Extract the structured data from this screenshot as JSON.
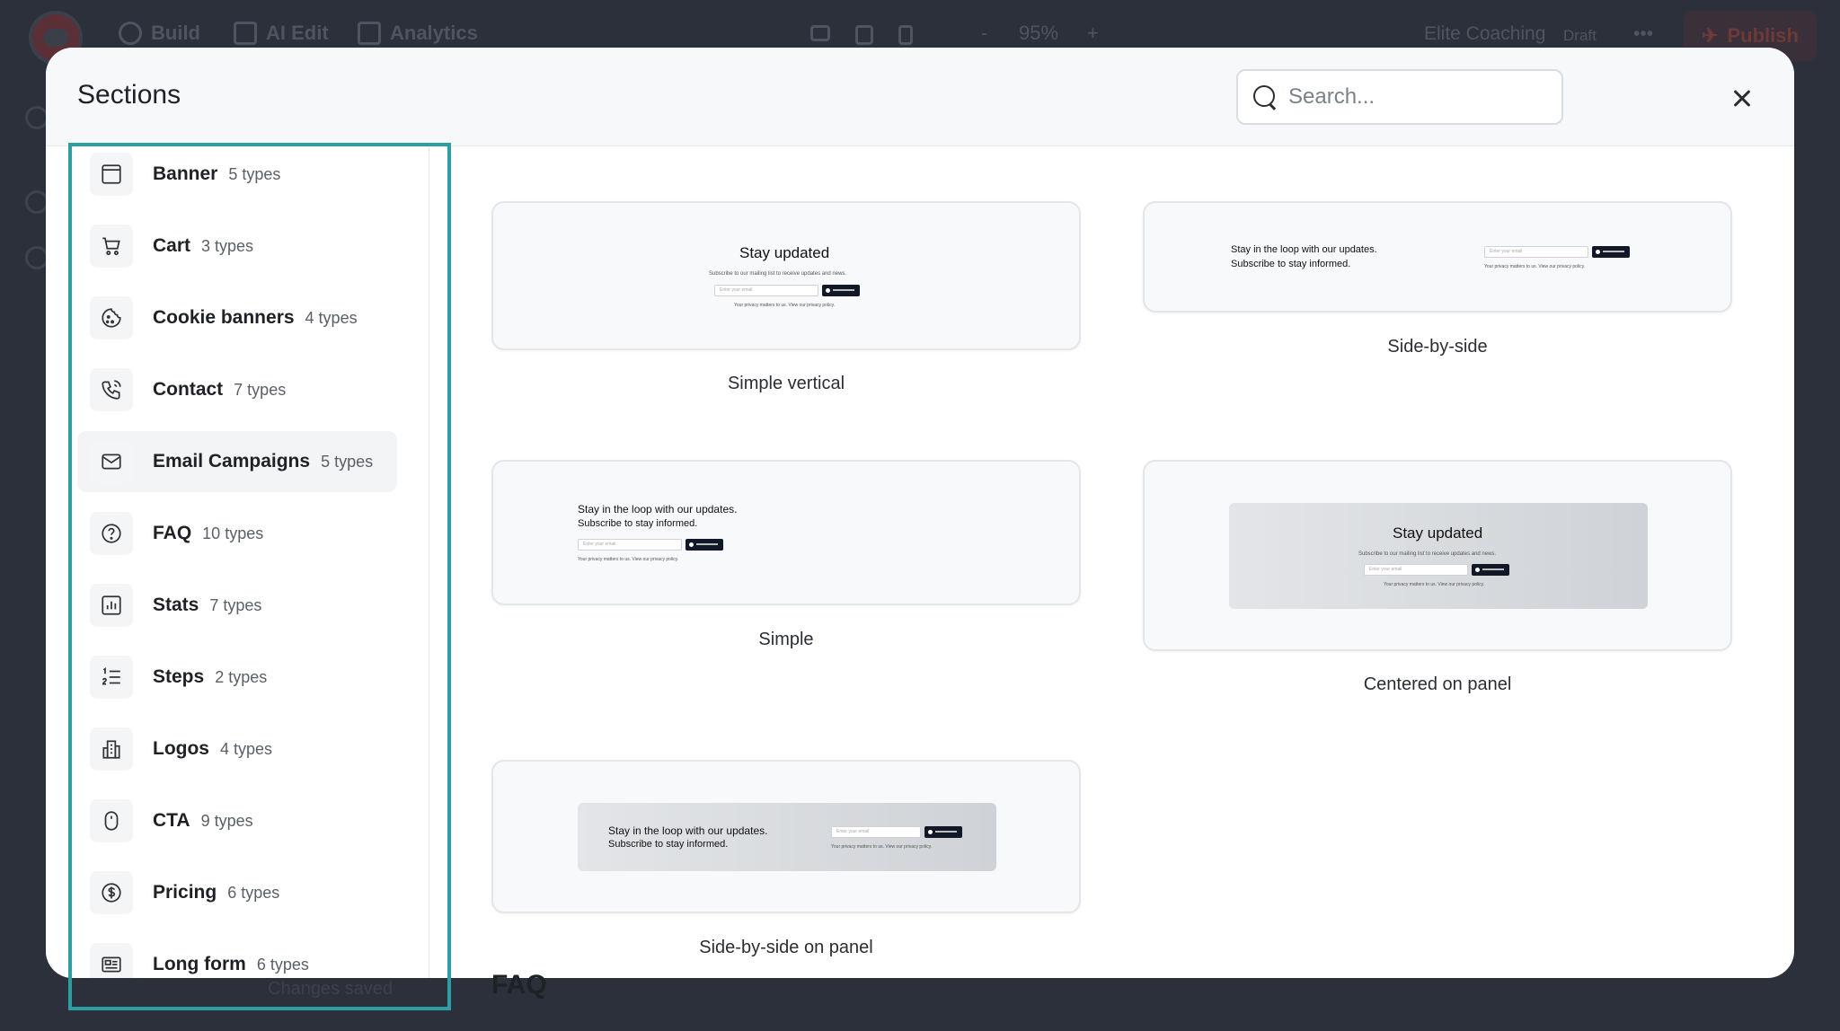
{
  "app": {
    "nav": [
      {
        "label": "Build",
        "icon": "globe-icon"
      },
      {
        "label": "AI Edit",
        "icon": "magic-wand-icon"
      },
      {
        "label": "Analytics",
        "icon": "bar-chart-icon"
      }
    ],
    "zoom_minus": "-",
    "zoom_level": "95%",
    "zoom_plus": "+",
    "site_name": "Elite Coaching",
    "status": "Draft",
    "more": "•••",
    "publish_label": "Publish",
    "save_status": "Changes saved"
  },
  "modal": {
    "title": "Sections",
    "search_placeholder": "Search...",
    "close_icon": "close-icon"
  },
  "sidebar": {
    "items": [
      {
        "label": "Banner",
        "count": "5 types",
        "icon": "banner-icon"
      },
      {
        "label": "Cart",
        "count": "3 types",
        "icon": "cart-icon"
      },
      {
        "label": "Cookie banners",
        "count": "4 types",
        "icon": "cookie-icon"
      },
      {
        "label": "Contact",
        "count": "7 types",
        "icon": "phone-icon"
      },
      {
        "label": "Email Campaigns",
        "count": "5 types",
        "icon": "mail-icon",
        "active": true
      },
      {
        "label": "FAQ",
        "count": "10 types",
        "icon": "question-icon"
      },
      {
        "label": "Stats",
        "count": "7 types",
        "icon": "stats-icon"
      },
      {
        "label": "Steps",
        "count": "2 types",
        "icon": "list-ordered-icon"
      },
      {
        "label": "Logos",
        "count": "4 types",
        "icon": "building-icon"
      },
      {
        "label": "CTA",
        "count": "9 types",
        "icon": "mouse-icon"
      },
      {
        "label": "Pricing",
        "count": "6 types",
        "icon": "dollar-icon"
      },
      {
        "label": "Long form",
        "count": "6 types",
        "icon": "long-form-icon"
      }
    ]
  },
  "content": {
    "cards": [
      {
        "label": "Simple vertical",
        "preview_title": "Stay updated",
        "preview_text": "Subscribe to our mailing list to receive updates and news.",
        "preview_input": "Enter your email",
        "preview_note": "Your privacy matters to us. View our privacy policy."
      },
      {
        "label": "Side-by-side",
        "preview_title": "Stay in the loop with our updates.",
        "preview_title2": "Subscribe to stay informed.",
        "preview_input": "Enter your email",
        "preview_note": "Your privacy matters to us. View our privacy policy."
      },
      {
        "label": "Simple",
        "preview_title": "Stay in the loop with our updates.",
        "preview_title2": "Subscribe to stay informed.",
        "preview_input": "Enter your email",
        "preview_note": "Your privacy matters to us. View our privacy policy."
      },
      {
        "label": "Centered on panel",
        "preview_title": "Stay updated",
        "preview_text": "Subscribe to our mailing list to receive updates and news.",
        "preview_input": "Enter your email",
        "preview_note": "Your privacy matters to us. View our privacy policy."
      },
      {
        "label": "Side-by-side on panel",
        "preview_title": "Stay in the loop with our updates.",
        "preview_title2": "Subscribe to stay informed.",
        "preview_input": "Enter your email",
        "preview_note": "Your privacy matters to us. View our privacy policy."
      }
    ],
    "next_section_heading": "FAQ"
  },
  "colors": {
    "highlight": "#2aa0a4",
    "overlay": "#2b303a",
    "button_dark": "#111827"
  }
}
